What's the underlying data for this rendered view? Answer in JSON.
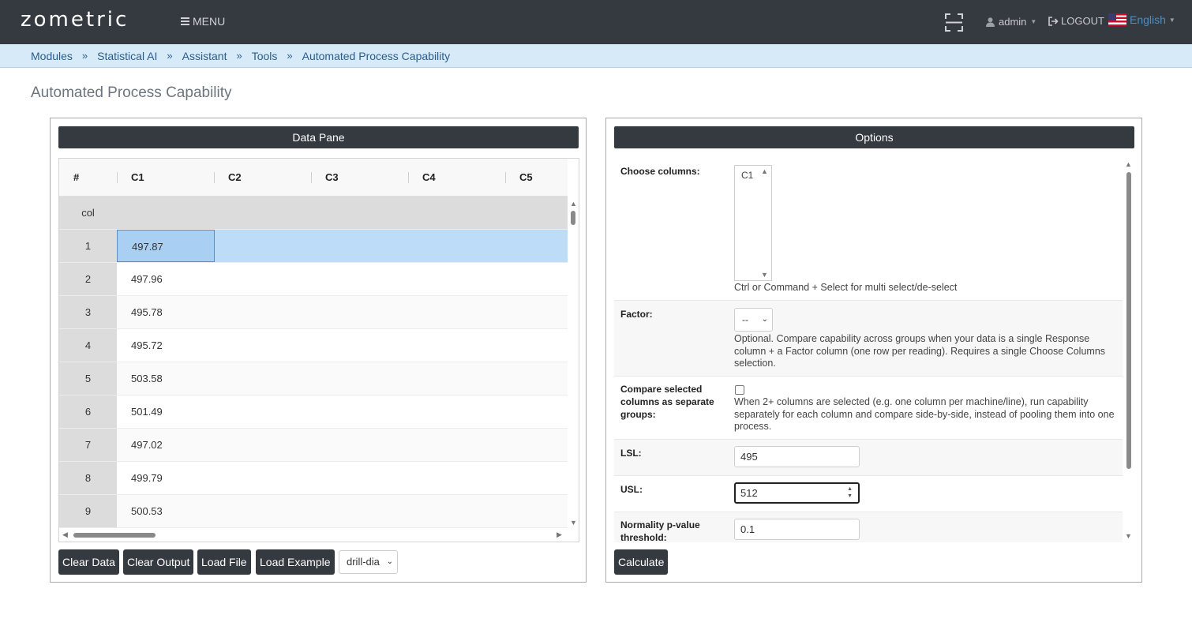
{
  "app": {
    "logo": "zometric",
    "menu_label": "MENU"
  },
  "user": {
    "name": "admin",
    "logout": "LOGOUT",
    "language": "English"
  },
  "breadcrumb": [
    "Modules",
    "Statistical AI",
    "Assistant",
    "Tools",
    "Automated Process Capability"
  ],
  "page_title": "Automated Process Capability",
  "data_pane": {
    "title": "Data Pane",
    "columns": [
      "#",
      "C1",
      "C2",
      "C3",
      "C4",
      "C5"
    ],
    "col_row_label": "col",
    "rows": [
      {
        "idx": "1",
        "c1": "497.87"
      },
      {
        "idx": "2",
        "c1": "497.96"
      },
      {
        "idx": "3",
        "c1": "495.78"
      },
      {
        "idx": "4",
        "c1": "495.72"
      },
      {
        "idx": "5",
        "c1": "503.58"
      },
      {
        "idx": "6",
        "c1": "501.49"
      },
      {
        "idx": "7",
        "c1": "497.02"
      },
      {
        "idx": "8",
        "c1": "499.79"
      },
      {
        "idx": "9",
        "c1": "500.53"
      }
    ],
    "buttons": {
      "clear_data": "Clear Data",
      "clear_output": "Clear Output",
      "load_file": "Load File",
      "load_example": "Load Example"
    },
    "example_select": "drill-dia"
  },
  "options": {
    "title": "Options",
    "choose_columns": {
      "label": "Choose columns:",
      "items": [
        "C1"
      ],
      "help": "Ctrl or Command + Select for multi select/de-select"
    },
    "factor": {
      "label": "Factor:",
      "value": "--",
      "help": "Optional. Compare capability across groups when your data is a single Response column + a Factor column (one row per reading). Requires a single Choose Columns selection."
    },
    "compare": {
      "label": "Compare selected columns as separate groups:",
      "checked": false,
      "help": "When 2+ columns are selected (e.g. one column per machine/line), run capability separately for each column and compare side-by-side, instead of pooling them into one process."
    },
    "lsl": {
      "label": "LSL:",
      "value": "495"
    },
    "usl": {
      "label": "USL:",
      "value": "512"
    },
    "normality": {
      "label": "Normality p-value threshold:",
      "value": "0.1"
    },
    "calculate": "Calculate"
  }
}
